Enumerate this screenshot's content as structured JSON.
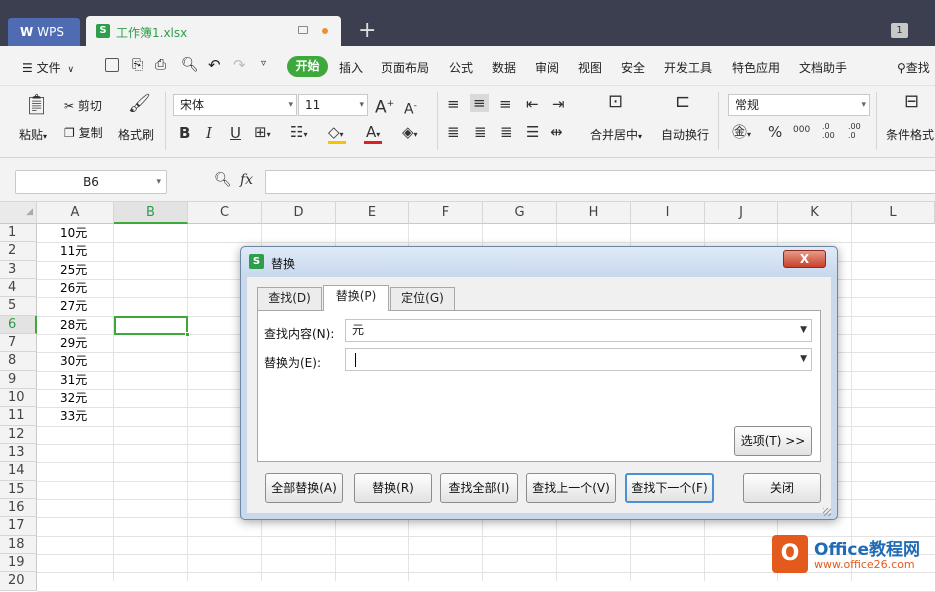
{
  "titlebar": {
    "app_tab": "WPS",
    "doc_tab": "工作簿1.xlsx",
    "new_tab": "+",
    "window_count": "1"
  },
  "menu": {
    "file": "文件",
    "items": [
      "开始",
      "插入",
      "页面布局",
      "公式",
      "数据",
      "审阅",
      "视图",
      "安全",
      "开发工具",
      "特色应用",
      "文档助手"
    ],
    "search": "查找"
  },
  "ribbon": {
    "paste": "粘贴",
    "cut": "剪切",
    "copy": "复制",
    "format_painter": "格式刷",
    "font_name": "宋体",
    "font_size": "11",
    "merge_center": "合并居中",
    "wrap_text": "自动换行",
    "number_format": "常规",
    "conditional_format": "条件格式",
    "bold": "B",
    "italic": "I",
    "underline": "U",
    "grow_font": "A",
    "shrink_font": "A",
    "percent": "%",
    "thousands": "000",
    "inc_decimal": ".0 .00",
    "dec_decimal": ".00 .0"
  },
  "formula_bar": {
    "name_box": "B6",
    "fx": "fx",
    "value": ""
  },
  "sheet": {
    "columns": [
      "A",
      "B",
      "C",
      "D",
      "E",
      "F",
      "G",
      "H",
      "I",
      "J",
      "K",
      "L"
    ],
    "selected_column": "B",
    "rows": [
      "1",
      "2",
      "3",
      "4",
      "5",
      "6",
      "7",
      "8",
      "9",
      "10",
      "11",
      "12",
      "13",
      "14",
      "15",
      "16",
      "17",
      "18",
      "19",
      "20"
    ],
    "selected_row": "6",
    "col_a_values": [
      "10元",
      "11元",
      "25元",
      "26元",
      "27元",
      "28元",
      "29元",
      "30元",
      "31元",
      "32元",
      "33元"
    ]
  },
  "dialog": {
    "title": "替换",
    "close": "X",
    "tabs": [
      "查找(D)",
      "替换(P)",
      "定位(G)"
    ],
    "active_tab": "替换(P)",
    "find_label": "查找内容(N):",
    "find_value": "元",
    "replace_label": "替换为(E):",
    "replace_value": "",
    "options_button": "选项(T) >>",
    "buttons": {
      "replace_all": "全部替换(A)",
      "replace": "替换(R)",
      "find_all": "查找全部(I)",
      "find_prev": "查找上一个(V)",
      "find_next": "查找下一个(F)",
      "close": "关闭"
    }
  },
  "watermark": {
    "brand": "Office教程网",
    "url": "www.office26.com"
  }
}
